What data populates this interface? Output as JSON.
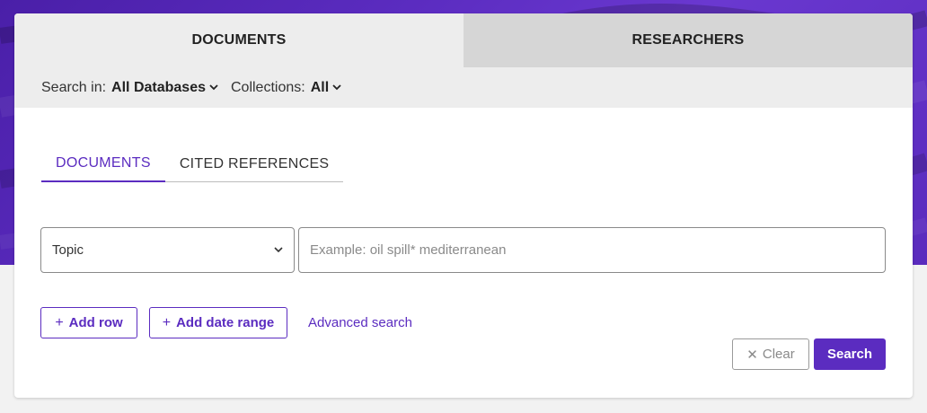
{
  "top_tabs": [
    {
      "label": "DOCUMENTS",
      "active": true
    },
    {
      "label": "RESEARCHERS",
      "active": false
    }
  ],
  "search_in": {
    "label": "Search in:",
    "value": "All Databases",
    "collections_label": "Collections:",
    "collections_value": "All"
  },
  "sub_tabs": [
    {
      "label": "DOCUMENTS",
      "active": true
    },
    {
      "label": "CITED REFERENCES",
      "active": false
    }
  ],
  "field_select": {
    "value": "Topic"
  },
  "query": {
    "value": "",
    "placeholder": "Example: oil spill* mediterranean"
  },
  "actions": {
    "add_row": "Add row",
    "add_date_range": "Add date range",
    "advanced_search": "Advanced search",
    "clear": "Clear",
    "search": "Search"
  },
  "colors": {
    "accent": "#5b2cc0",
    "tab_active_bg": "#ededed",
    "tab_inactive_bg": "#d6d6d6"
  }
}
